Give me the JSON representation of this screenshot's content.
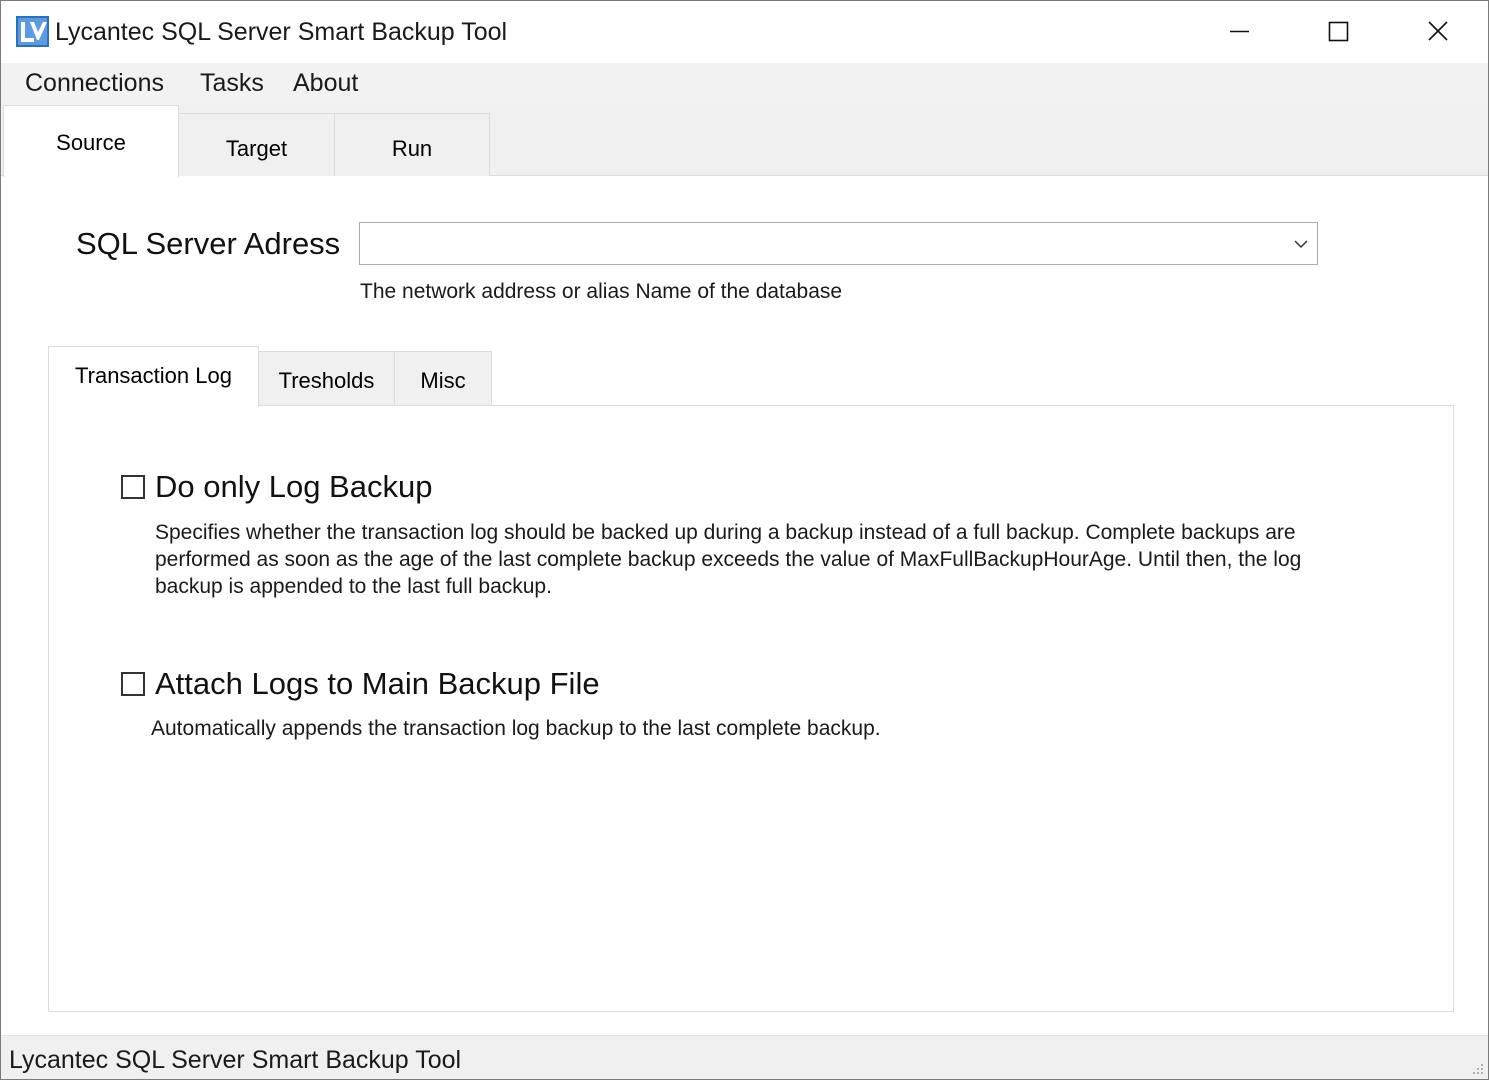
{
  "window": {
    "title": "Lycantec SQL Server Smart Backup Tool",
    "app_icon": "lycantec-logo-icon",
    "controls": [
      "minimize-icon",
      "maximize-icon",
      "close-icon"
    ]
  },
  "menu": {
    "items": [
      {
        "label": "Connections"
      },
      {
        "label": "Tasks"
      },
      {
        "label": "About"
      }
    ]
  },
  "main_tabs": {
    "selected": "Source",
    "tabs": [
      {
        "label": "Source"
      },
      {
        "label": "Target"
      },
      {
        "label": "Run"
      }
    ]
  },
  "source": {
    "sql_server_label": "SQL Server Adress",
    "sql_server_value": "",
    "sql_server_hint": "The network address or alias Name of the database",
    "dropdown_icon": "chevron-down-icon"
  },
  "sub_tabs": {
    "selected": "Transaction Log",
    "tabs": [
      {
        "label": "Transaction Log"
      },
      {
        "label": "Tresholds"
      },
      {
        "label": "Misc"
      }
    ]
  },
  "transaction_log": {
    "do_only_log_backup": {
      "label": "Do only Log Backup",
      "checked": false,
      "description": "Specifies whether the transaction log should be backed up during a backup instead of a full backup. Complete backups are performed as soon as the age of the last complete backup exceeds the value of MaxFullBackupHourAge. Until then, the log backup is appended to the last full backup."
    },
    "attach_logs": {
      "label": "Attach Logs to Main Backup File",
      "checked": false,
      "description": "Automatically appends the transaction log backup to the last complete backup."
    }
  },
  "statusbar": {
    "text": "Lycantec SQL Server Smart Backup Tool"
  },
  "colors": {
    "menu_bg": "#f2f2f2",
    "tab_bg": "#f0f0f0",
    "border": "#dcdcdc",
    "icon_blue": "#1e5fb4"
  }
}
